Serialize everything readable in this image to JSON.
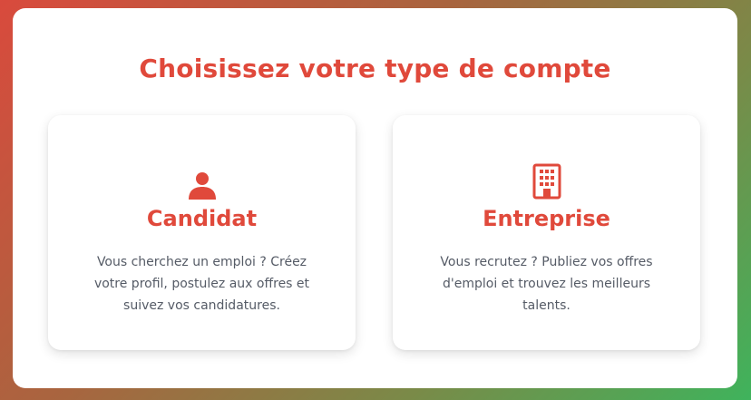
{
  "page": {
    "title": "Choisissez votre type de compte"
  },
  "cards": {
    "candidat": {
      "icon": "user-icon",
      "title": "Candidat",
      "description": "Vous cherchez un emploi ? Créez votre profil, postulez aux offres et suivez vos candidatures."
    },
    "entreprise": {
      "icon": "building-icon",
      "title": "Entreprise",
      "description": "Vous recrutez ? Publiez vos offres d'emploi et trouvez les meilleurs talents."
    }
  },
  "colors": {
    "accent": "#e0493b",
    "text_muted": "#555b66",
    "gradient_start": "#d94a3d",
    "gradient_end": "#3fb35c"
  }
}
